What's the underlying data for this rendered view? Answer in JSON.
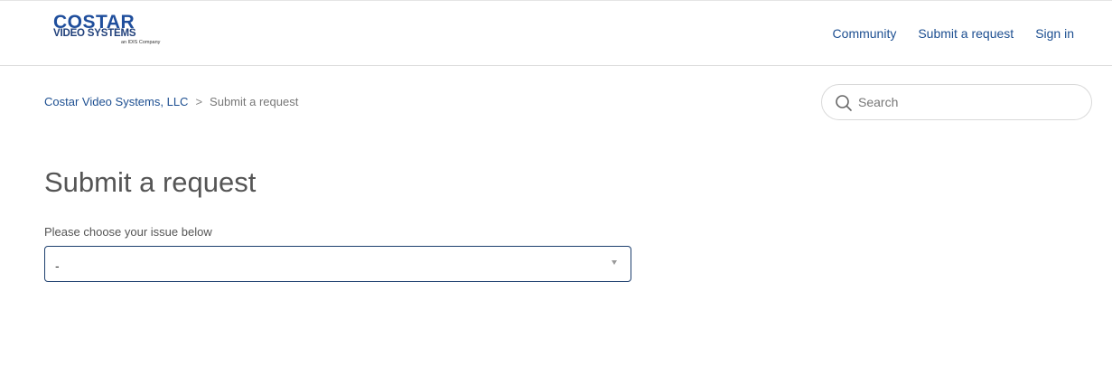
{
  "header": {
    "logo": {
      "name": "COSTAR",
      "subtitle": "VIDEO SYSTEMS",
      "tagline": "an IDIS Company"
    },
    "nav": [
      {
        "label": "Community"
      },
      {
        "label": "Submit a request"
      },
      {
        "label": "Sign in"
      }
    ]
  },
  "breadcrumbs": {
    "home": "Costar Video Systems, LLC",
    "separator": ">",
    "current": "Submit a request"
  },
  "search": {
    "placeholder": "Search",
    "value": ""
  },
  "main": {
    "title": "Submit a request",
    "issue_field": {
      "label": "Please choose your issue below",
      "selected": "-"
    }
  },
  "colors": {
    "link": "#1d4f91",
    "logo_blue": "#1f4e9c",
    "text": "#555555",
    "select_border": "#1d3f6e"
  }
}
